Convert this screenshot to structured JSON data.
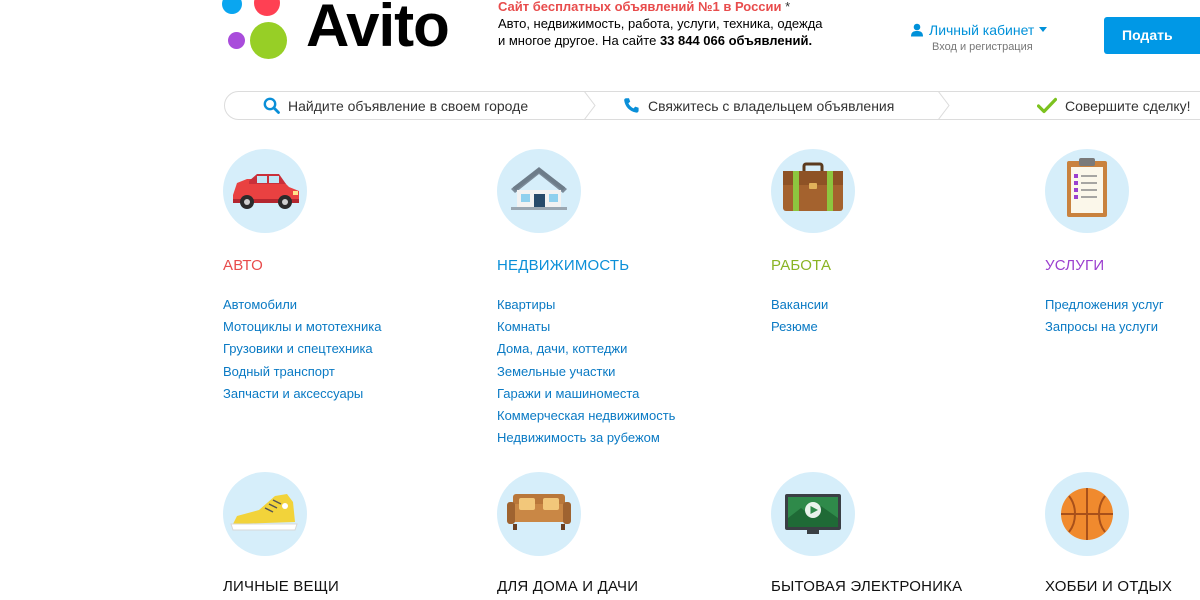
{
  "header": {
    "logo_text": "Avito",
    "tagline_highlight": "Сайт бесплатных объявлений №1 в России",
    "tagline_star": " *",
    "tagline_line1": "Авто, недвижимость, работа, услуги, техника, одежда",
    "tagline_line2_prefix": "и многое другое. На сайте ",
    "tagline_count": "33 844 066 объявлений.",
    "account_label": "Личный кабинет",
    "account_sub": "Вход и регистрация",
    "post_button": "Подать объявление"
  },
  "steps": [
    {
      "label": "Найдите объявление в своем городе",
      "icon": "search-icon"
    },
    {
      "label": "Свяжитесь с владельцем объявления",
      "icon": "phone-icon"
    },
    {
      "label": "Совершите сделку!",
      "icon": "checkmark-icon"
    }
  ],
  "categories": [
    {
      "title": "Авто",
      "color": "#e84c4c",
      "icon": "car-icon",
      "links": [
        "Автомобили",
        "Мотоциклы и мототехника",
        "Грузовики и спецтехника",
        "Водный транспорт",
        "Запчасти и аксессуары"
      ]
    },
    {
      "title": "Недвижимость",
      "color": "#0a8fd8",
      "icon": "house-icon",
      "links": [
        "Квартиры",
        "Комнаты",
        "Дома, дачи, коттеджи",
        "Земельные участки",
        "Гаражи и машиноместа",
        "Коммерческая недвижимость",
        "Недвижимость за рубежом"
      ]
    },
    {
      "title": "Работа",
      "color": "#8ab424",
      "icon": "briefcase-icon",
      "links": [
        "Вакансии",
        "Резюме"
      ]
    },
    {
      "title": "Услуги",
      "color": "#9b3fcf",
      "icon": "clipboard-icon",
      "links": [
        "Предложения услуг",
        "Запросы на услуги"
      ]
    },
    {
      "title": "Личные вещи",
      "color": "#111111",
      "icon": "sneaker-icon",
      "links": []
    },
    {
      "title": "Для дома и дачи",
      "color": "#111111",
      "icon": "sofa-icon",
      "links": []
    },
    {
      "title": "Бытовая электроника",
      "color": "#111111",
      "icon": "monitor-icon",
      "links": []
    },
    {
      "title": "Хобби и отдых",
      "color": "#111111",
      "icon": "basketball-icon",
      "links": []
    }
  ]
}
